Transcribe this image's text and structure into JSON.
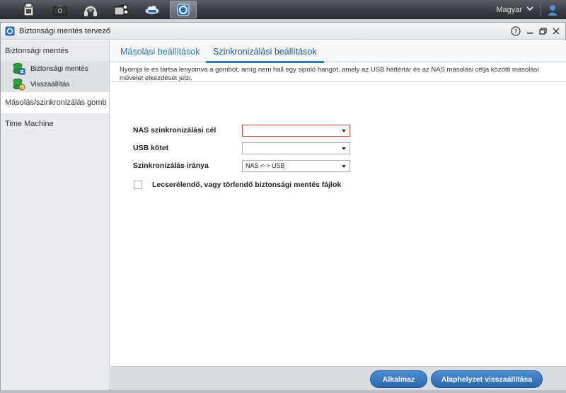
{
  "language": "Magyar",
  "window": {
    "title": "Biztonsági mentés tervező"
  },
  "sidebar": {
    "groups": [
      {
        "label": "Biztonsági mentés"
      },
      {
        "label": "Másolás/szinkronizálás gomb"
      },
      {
        "label": "Time Machine"
      }
    ],
    "items": [
      {
        "label": "Biztonsági mentés"
      },
      {
        "label": "Visszaállítás"
      }
    ]
  },
  "tabs": [
    {
      "label": "Másolási beállítások"
    },
    {
      "label": "Szinkronizálási beállítások"
    }
  ],
  "info_text": "Nyomja le és tartsa lenyomva a gombot, amíg nem hall egy sipoló hangot, amely az USB háttértár és az NAS másolási célja közötti másolási művelet elkezdését jelzi.",
  "form": {
    "nas_target": {
      "label": "NAS szinkronizálási cél",
      "value": ""
    },
    "usb_volume": {
      "label": "USB kötet",
      "value": ""
    },
    "sync_direction": {
      "label": "Szinkronizálás iránya",
      "value": "NAS <-> USB"
    },
    "replace_checkbox": {
      "label": "Lecserélendő, vagy törlendő biztonsági mentés fájlok",
      "checked": false
    }
  },
  "buttons": {
    "apply": "Alkalmaz",
    "reset": "Alaphelyzet visszaállítása"
  },
  "colors": {
    "accent": "#2e7ac4",
    "error_border": "#c9453a",
    "button": "#3a7bc0"
  }
}
